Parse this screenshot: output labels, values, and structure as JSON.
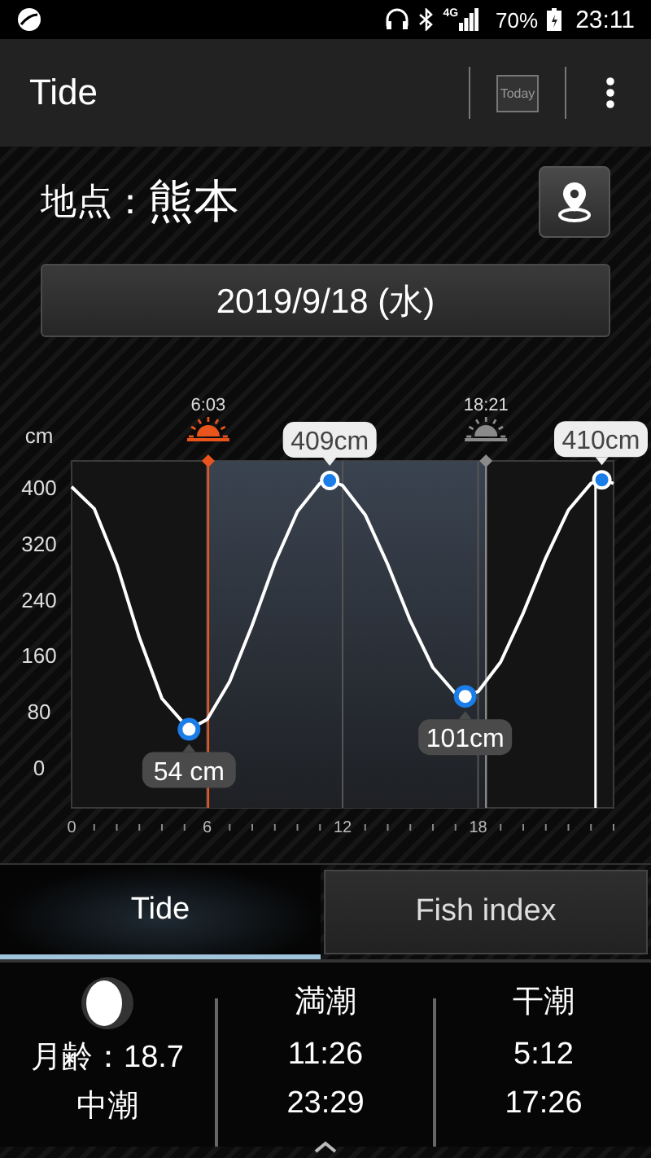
{
  "status_bar": {
    "network": "4G",
    "battery": "70%",
    "time": "23:11"
  },
  "app_bar": {
    "title": "Tide",
    "today_button": "Today"
  },
  "location": {
    "label": "地点：",
    "name": "熊本"
  },
  "date": "2019/9/18 (水)",
  "chart": {
    "chart_data": {
      "type": "line",
      "ylabel": "cm",
      "x": [
        0,
        1,
        2,
        3,
        4,
        5.2,
        6,
        7,
        8,
        9,
        10,
        11,
        11.43,
        12,
        13,
        14,
        15,
        16,
        17,
        17.43,
        18,
        19,
        20,
        21,
        22,
        23,
        23.48,
        24
      ],
      "series": [
        {
          "color": "#ffffff",
          "values": [
            400,
            369,
            289,
            185,
            98,
            54,
            68,
            122,
            203,
            292,
            365,
            405,
            409,
            402,
            360,
            289,
            209,
            142,
            105,
            101,
            108,
            150,
            220,
            299,
            367,
            405,
            410,
            405
          ]
        }
      ],
      "xlim": [
        0,
        24
      ],
      "ylim": [
        -58,
        437
      ],
      "xticks": [
        0,
        6,
        12,
        18
      ],
      "yticks": [
        0,
        80,
        160,
        240,
        320,
        400
      ],
      "grid": true,
      "bands": [
        {
          "axis": "x",
          "from": 6.05,
          "to": 18.35,
          "color": "#3a4350"
        }
      ],
      "ref_lines": [
        {
          "axis": "x",
          "value": 6.05,
          "label": "6:03",
          "color": "#e8541c"
        },
        {
          "axis": "x",
          "value": 18.35,
          "label": "18:21",
          "color": "#8a8a8a"
        },
        {
          "axis": "x",
          "value": 23.2,
          "color": "#ffffff"
        }
      ],
      "annotations": [
        {
          "text": "409cm",
          "x": 11.43,
          "y": 409
        },
        {
          "text": "54 cm",
          "x": 5.2,
          "y": 54
        },
        {
          "text": "101cm",
          "x": 17.43,
          "y": 101
        },
        {
          "text": "410cm",
          "x": 23.48,
          "y": 410
        }
      ]
    }
  },
  "tabs": [
    {
      "label": "Tide",
      "selected": true
    },
    {
      "label": "Fish index",
      "selected": false
    }
  ],
  "info": {
    "moon": {
      "age": "月齢：18.7",
      "tide_type": "中潮"
    },
    "columns": [
      {
        "title": "満潮",
        "times": [
          "11:26",
          "23:29"
        ]
      },
      {
        "title": "干潮",
        "times": [
          "5:12",
          "17:26"
        ]
      }
    ]
  }
}
